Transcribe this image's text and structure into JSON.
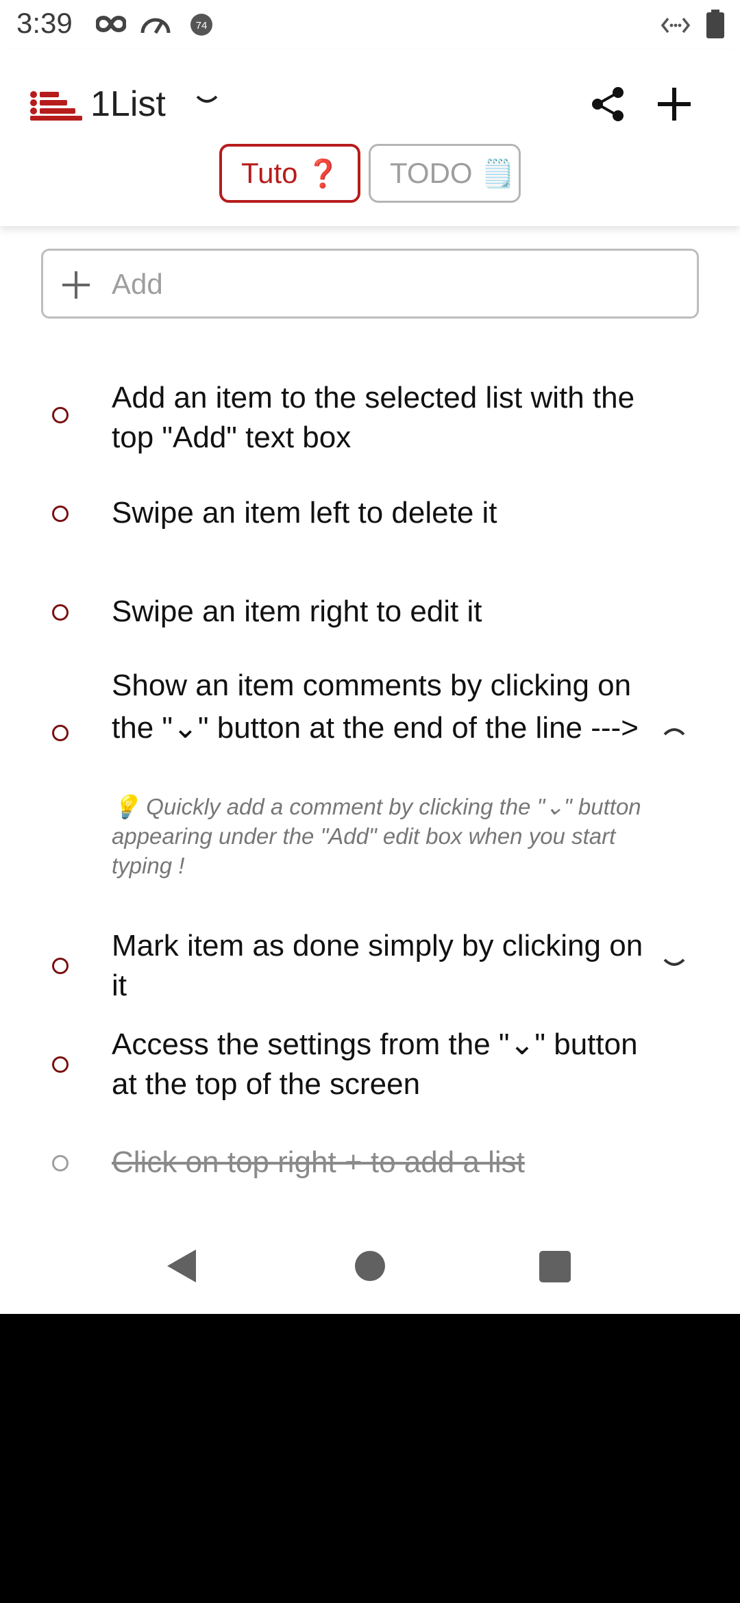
{
  "status_bar": {
    "time": "3:39",
    "icons": [
      "infinity-icon",
      "speedometer-icon",
      "notification-badge-icon",
      "code-icon",
      "battery-icon"
    ],
    "badge_count": "74"
  },
  "header": {
    "title": "1List",
    "tabs": [
      {
        "label": "Tuto",
        "emoji": "❓",
        "active": true
      },
      {
        "label": "TODO",
        "emoji": "🗒️",
        "active": false
      }
    ]
  },
  "add_box": {
    "placeholder": "Add"
  },
  "items": [
    {
      "text": "Add an item to the selected list with the top \"Add\" text box",
      "done": false
    },
    {
      "text": "Swipe an item left to delete it",
      "done": false
    },
    {
      "text": "Swipe an item right to edit it",
      "done": false
    },
    {
      "text": "Show an item comments by clicking on the \"⌄\" button at the end of the line --->",
      "done": false,
      "expanded": true,
      "comment": "💡 Quickly add a comment by clicking the \"⌄\" button appearing under the \"Add\" edit box when you start typing !"
    },
    {
      "text": "Mark item as done simply by clicking on it",
      "done": false,
      "has_comment": true
    },
    {
      "text": "Access the settings from the \"⌄\" button at the top of the screen",
      "done": false
    },
    {
      "text": "Click on top right + to add a list",
      "done": true
    }
  ],
  "colors": {
    "accent": "#b71c1c",
    "bullet": "#7a0f0f",
    "inactive": "#9e9e9e"
  }
}
